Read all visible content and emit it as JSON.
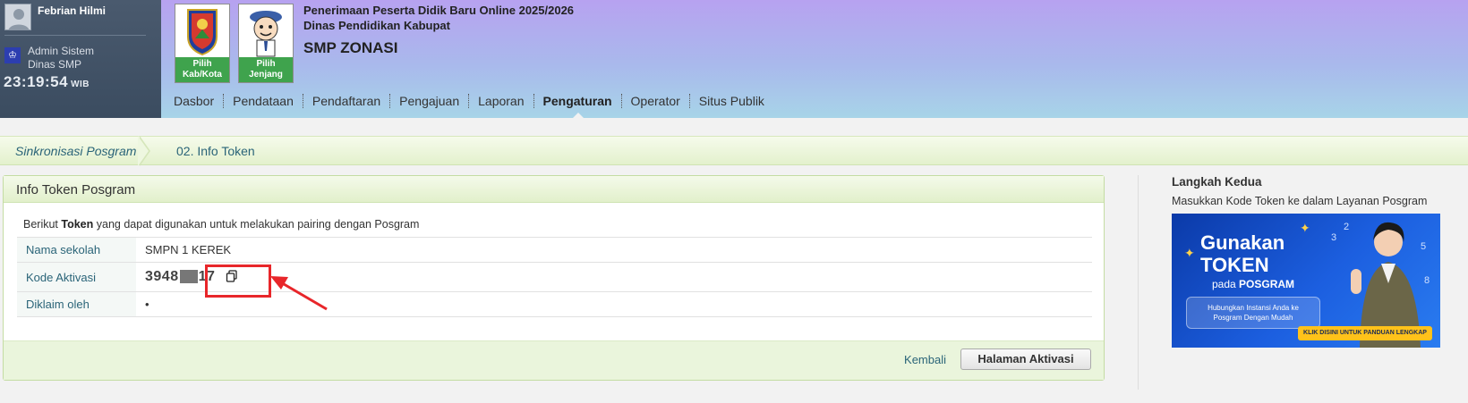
{
  "user": {
    "name": "Febrian Hilmi",
    "role_line1": "Admin Sistem",
    "role_line2": "Dinas SMP",
    "clock": "23:19:54",
    "timezone": "WIB"
  },
  "header": {
    "pick_city_label_1": "Pilih",
    "pick_city_label_2": "Kab/Kota",
    "pick_level_label_1": "Pilih",
    "pick_level_label_2": "Jenjang",
    "title_line1": "Penerimaan Peserta Didik Baru Online 2025/2026",
    "title_line2": "Dinas Pendidikan Kabupat",
    "subtitle": "SMP ZONASI"
  },
  "nav": {
    "items": [
      "Dasbor",
      "Pendataan",
      "Pendaftaran",
      "Pengajuan",
      "Laporan",
      "Pengaturan",
      "Operator",
      "Situs Publik"
    ],
    "active_index": 5
  },
  "breadcrumb": {
    "item1": "Sinkronisasi Posgram",
    "item2": "02. Info Token"
  },
  "panel": {
    "title": "Info Token Posgram",
    "intro_prefix": "Berikut ",
    "intro_bold": "Token",
    "intro_suffix": " yang dapat digunakan untuk melakukan pairing dengan Posgram",
    "rows": [
      {
        "label": "Nama sekolah",
        "value": "SMPN 1 KEREK"
      },
      {
        "label": "Kode Aktivasi",
        "value_start": "3948",
        "value_end": "17"
      },
      {
        "label": "Diklaim oleh",
        "value": "•"
      }
    ],
    "back_label": "Kembali",
    "activate_label": "Halaman Aktivasi"
  },
  "side": {
    "title": "Langkah Kedua",
    "description": "Masukkan Kode Token ke dalam Layanan Posgram",
    "banner": {
      "line1": "Gunakan",
      "line2": "TOKEN",
      "line3_prefix": "pada ",
      "line3_bold": "POSGRAM",
      "pill_line1": "Hubungkan Instansi Anda ke",
      "pill_line2": "Posgram Dengan Mudah",
      "cta": "KLIK DISINI UNTUK PANDUAN LENGKAP"
    }
  },
  "colors": {
    "accent_green": "#3fa34d",
    "link": "#2a6478",
    "highlight": "#e8262a"
  }
}
